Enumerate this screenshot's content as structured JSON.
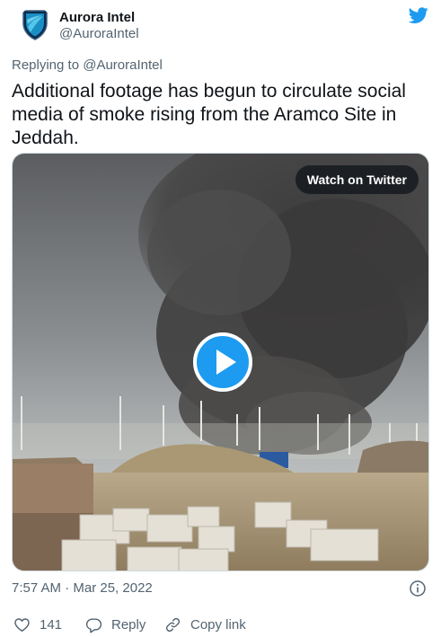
{
  "author": {
    "name": "Aurora Intel",
    "handle": "@AuroraIntel",
    "avatar_icon": "shield-logo-icon",
    "platform_icon": "twitter-bird-icon"
  },
  "replying": {
    "prefix": "Replying to ",
    "handle": "@AuroraIntel"
  },
  "tweet": {
    "text": "Additional footage has begun to circulate social media of smoke rising from the Aramco Site in Jeddah."
  },
  "media": {
    "watch_label": "Watch on Twitter",
    "play_icon": "play-icon"
  },
  "timestamp": "7:57 AM · Mar 25, 2022",
  "actions": {
    "likes_count": "141",
    "reply_label": "Reply",
    "copy_label": "Copy link"
  },
  "colors": {
    "accent": "#1d9bf0",
    "text": "#0f1419",
    "muted": "#536471"
  }
}
